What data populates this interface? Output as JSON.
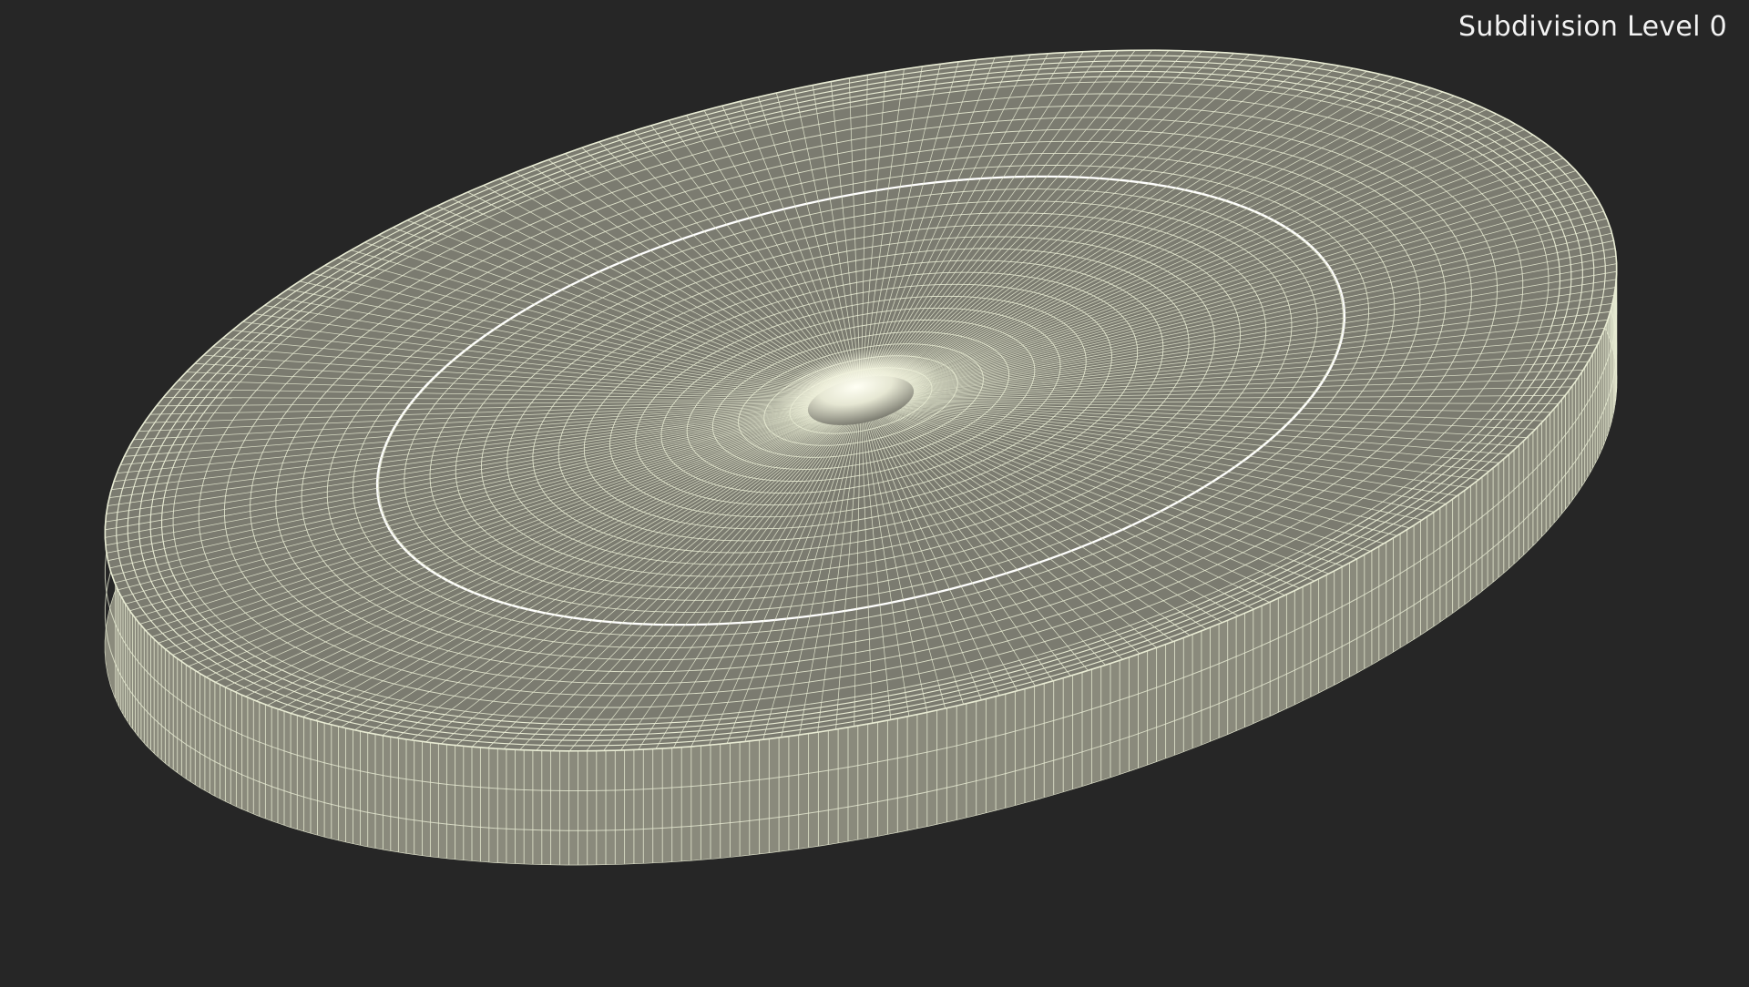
{
  "viewport": {
    "background": "#262626",
    "overlay_label": "Subdivision Level 0"
  },
  "model": {
    "shape": "coin-disc",
    "render_mode": "wireframe-on-shaded",
    "surface_color": "#7b7b70",
    "wire_color": "#e9ecd4",
    "rim_color": "#8a8a7c"
  }
}
